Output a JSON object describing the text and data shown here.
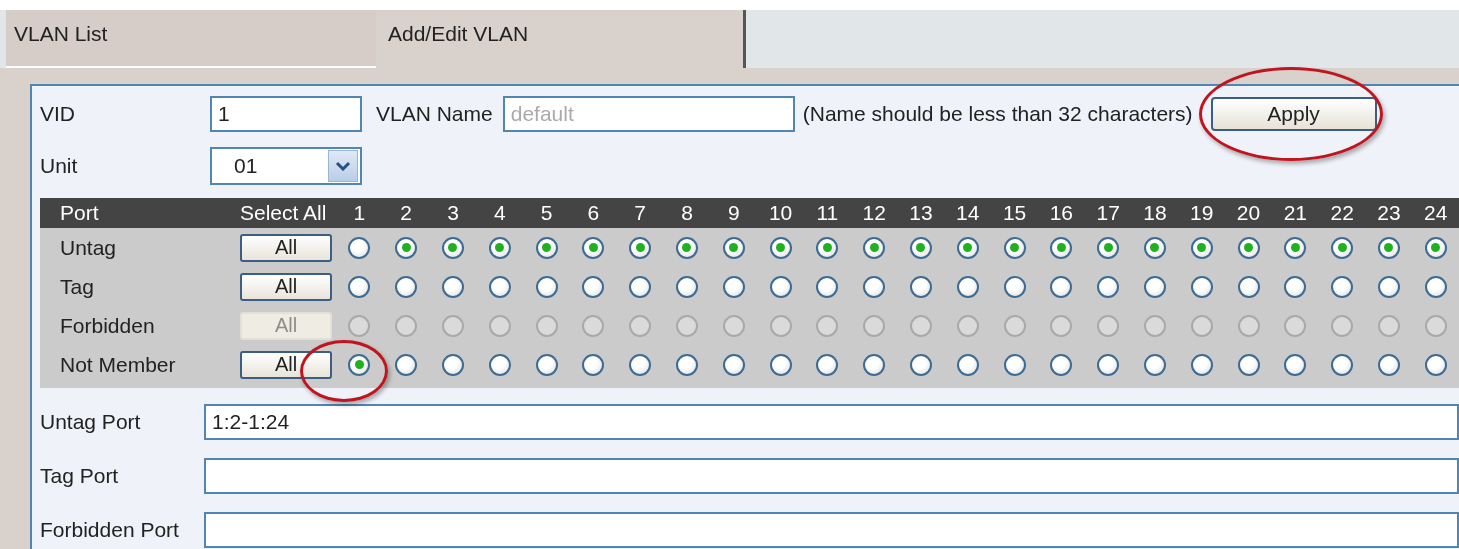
{
  "tabs": [
    {
      "label": "VLAN List",
      "selected": false
    },
    {
      "label": "Add/Edit VLAN",
      "selected": true
    }
  ],
  "form": {
    "vid": {
      "label": "VID",
      "value": "1"
    },
    "vlan_name": {
      "label": "VLAN Name",
      "placeholder": "default",
      "note": "(Name should be less than 32 characters)"
    },
    "apply": {
      "label": "Apply",
      "highlighted": true
    },
    "unit": {
      "label": "Unit",
      "value": "01"
    }
  },
  "port_table": {
    "header": {
      "port": "Port",
      "select_all": "Select All",
      "ports": [
        "1",
        "2",
        "3",
        "4",
        "5",
        "6",
        "7",
        "8",
        "9",
        "10",
        "11",
        "12",
        "13",
        "14",
        "15",
        "16",
        "17",
        "18",
        "19",
        "20",
        "21",
        "22",
        "23",
        "24"
      ]
    },
    "rows": [
      {
        "label": "Untag",
        "all_button": "All",
        "disabled": false,
        "ports": [
          {
            "selected": false
          },
          {
            "selected": true
          },
          {
            "selected": true
          },
          {
            "selected": true
          },
          {
            "selected": true
          },
          {
            "selected": true
          },
          {
            "selected": true
          },
          {
            "selected": true
          },
          {
            "selected": true
          },
          {
            "selected": true
          },
          {
            "selected": true
          },
          {
            "selected": true
          },
          {
            "selected": true
          },
          {
            "selected": true
          },
          {
            "selected": true
          },
          {
            "selected": true
          },
          {
            "selected": true
          },
          {
            "selected": true
          },
          {
            "selected": true
          },
          {
            "selected": true
          },
          {
            "selected": true
          },
          {
            "selected": true
          },
          {
            "selected": true
          },
          {
            "selected": true
          }
        ]
      },
      {
        "label": "Tag",
        "all_button": "All",
        "disabled": false,
        "ports": [
          {
            "selected": false
          },
          {
            "selected": false
          },
          {
            "selected": false
          },
          {
            "selected": false
          },
          {
            "selected": false
          },
          {
            "selected": false
          },
          {
            "selected": false
          },
          {
            "selected": false
          },
          {
            "selected": false
          },
          {
            "selected": false
          },
          {
            "selected": false
          },
          {
            "selected": false
          },
          {
            "selected": false
          },
          {
            "selected": false
          },
          {
            "selected": false
          },
          {
            "selected": false
          },
          {
            "selected": false
          },
          {
            "selected": false
          },
          {
            "selected": false
          },
          {
            "selected": false
          },
          {
            "selected": false
          },
          {
            "selected": false
          },
          {
            "selected": false
          },
          {
            "selected": false
          }
        ]
      },
      {
        "label": "Forbidden",
        "all_button": "All",
        "disabled": true,
        "ports": [
          {
            "selected": false
          },
          {
            "selected": false
          },
          {
            "selected": false
          },
          {
            "selected": false
          },
          {
            "selected": false
          },
          {
            "selected": false
          },
          {
            "selected": false
          },
          {
            "selected": false
          },
          {
            "selected": false
          },
          {
            "selected": false
          },
          {
            "selected": false
          },
          {
            "selected": false
          },
          {
            "selected": false
          },
          {
            "selected": false
          },
          {
            "selected": false
          },
          {
            "selected": false
          },
          {
            "selected": false
          },
          {
            "selected": false
          },
          {
            "selected": false
          },
          {
            "selected": false
          },
          {
            "selected": false
          },
          {
            "selected": false
          },
          {
            "selected": false
          },
          {
            "selected": false
          }
        ]
      },
      {
        "label": "Not Member",
        "all_button": "All",
        "disabled": false,
        "ports": [
          {
            "selected": true,
            "highlighted": true
          },
          {
            "selected": false
          },
          {
            "selected": false
          },
          {
            "selected": false
          },
          {
            "selected": false
          },
          {
            "selected": false
          },
          {
            "selected": false
          },
          {
            "selected": false
          },
          {
            "selected": false
          },
          {
            "selected": false
          },
          {
            "selected": false
          },
          {
            "selected": false
          },
          {
            "selected": false
          },
          {
            "selected": false
          },
          {
            "selected": false
          },
          {
            "selected": false
          },
          {
            "selected": false
          },
          {
            "selected": false
          },
          {
            "selected": false
          },
          {
            "selected": false
          },
          {
            "selected": false
          },
          {
            "selected": false
          },
          {
            "selected": false
          },
          {
            "selected": false
          }
        ]
      }
    ]
  },
  "port_fields": [
    {
      "label": "Untag Port",
      "value": "1:2-1:24"
    },
    {
      "label": "Tag Port"
    },
    {
      "label": "Forbidden Port"
    }
  ]
}
